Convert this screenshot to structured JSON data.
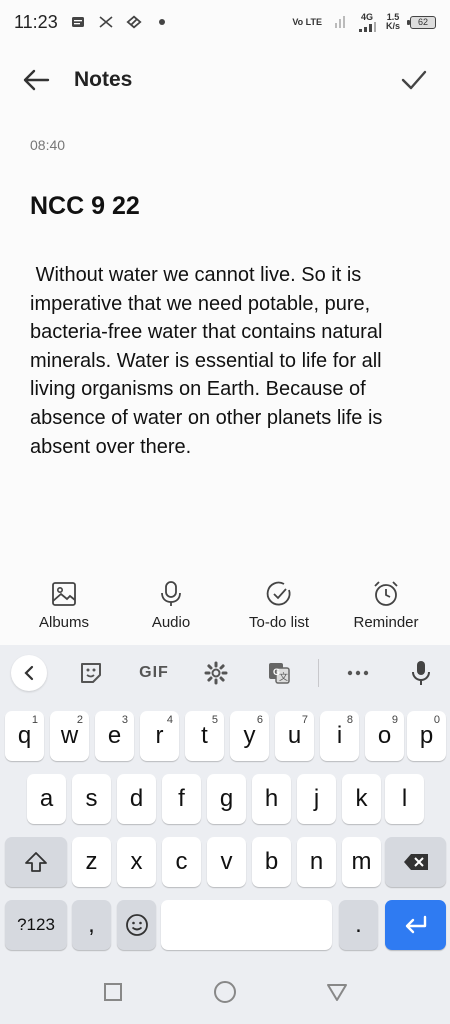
{
  "status_bar": {
    "time": "11:23",
    "network_label": "Vo LTE",
    "signal_gen": "4G",
    "speed_value": "1.5",
    "speed_unit": "K/s",
    "battery": "62"
  },
  "app_bar": {
    "title": "Notes",
    "back_icon": "arrow-left-icon",
    "confirm_icon": "check-icon"
  },
  "note": {
    "time": "08:40",
    "title": "NCC 9 22",
    "body": " Without water we cannot live. So it is imperative that we need potable, pure, bacteria-free water that contains natural minerals. Water is essential to life for all living organisms on Earth. Because of absence of water on other planets life is absent over there."
  },
  "tools": [
    {
      "label": "Albums",
      "icon": "image-icon"
    },
    {
      "label": "Audio",
      "icon": "microphone-icon"
    },
    {
      "label": "To-do list",
      "icon": "check-circle-icon"
    },
    {
      "label": "Reminder",
      "icon": "alarm-clock-icon"
    }
  ],
  "keyboard": {
    "toolbar": {
      "gif_label": "GIF"
    },
    "row1": [
      {
        "key": "q",
        "num": "1"
      },
      {
        "key": "w",
        "num": "2"
      },
      {
        "key": "e",
        "num": "3"
      },
      {
        "key": "r",
        "num": "4"
      },
      {
        "key": "t",
        "num": "5"
      },
      {
        "key": "y",
        "num": "6"
      },
      {
        "key": "u",
        "num": "7"
      },
      {
        "key": "i",
        "num": "8"
      },
      {
        "key": "o",
        "num": "9"
      },
      {
        "key": "p",
        "num": "0"
      }
    ],
    "row2": [
      "a",
      "s",
      "d",
      "f",
      "g",
      "h",
      "j",
      "k",
      "l"
    ],
    "row3": [
      "z",
      "x",
      "c",
      "v",
      "b",
      "n",
      "m"
    ],
    "row4": {
      "symbols_label": "?123",
      "comma_label": ",",
      "period_label": "."
    }
  }
}
